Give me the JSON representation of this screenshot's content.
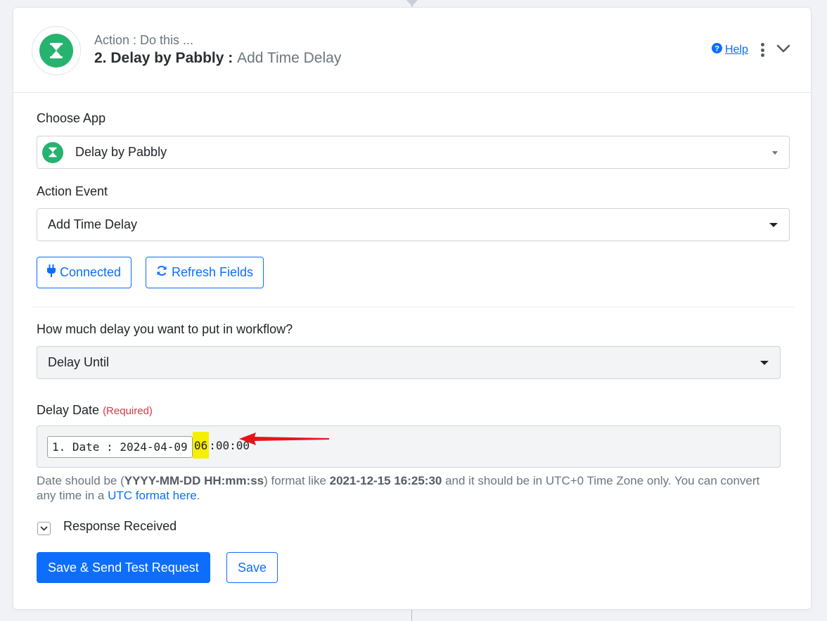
{
  "header": {
    "subtitle": "Action : Do this ...",
    "title_app": "2. Delay by Pabbly :",
    "title_event": "Add Time Delay",
    "help_label": "Help"
  },
  "choose_app": {
    "label": "Choose App",
    "value": "Delay by Pabbly"
  },
  "action_event": {
    "label": "Action Event",
    "value": "Add Time Delay"
  },
  "buttons": {
    "connected": "Connected",
    "refresh": "Refresh Fields",
    "save_send": "Save & Send Test Request",
    "save": "Save"
  },
  "delay_type": {
    "label": "How much delay you want to put in workflow?",
    "value": "Delay Until"
  },
  "delay_date": {
    "label": "Delay Date",
    "required": "(Required)",
    "token": "1. Date : 2024-04-09",
    "typed_highlight": "06",
    "typed_rest": ":00:00"
  },
  "help_text": {
    "p1": "Date should be (",
    "b1": "YYYY-MM-DD HH:mm:ss",
    "p2": ") format like ",
    "b2": "2021-12-15 16:25:30",
    "p3": " and it should be in UTC+0 Time Zone only. You can convert any time in a ",
    "link": "UTC format here",
    "p4": "."
  },
  "response": {
    "label": "Response Received"
  },
  "colors": {
    "brand_green": "#26b36f",
    "primary_blue": "#0d6efd",
    "required_red": "#dc3545",
    "highlight_yellow": "#f5ef00",
    "annotation_red": "#e8141a"
  },
  "icons": {
    "app": "hourglass-icon",
    "help": "question-circle-icon",
    "menu": "kebab-menu-icon",
    "collapse": "chevron-down-icon",
    "connected": "plug-icon",
    "refresh": "refresh-icon",
    "annotation": "red-arrow-icon"
  }
}
